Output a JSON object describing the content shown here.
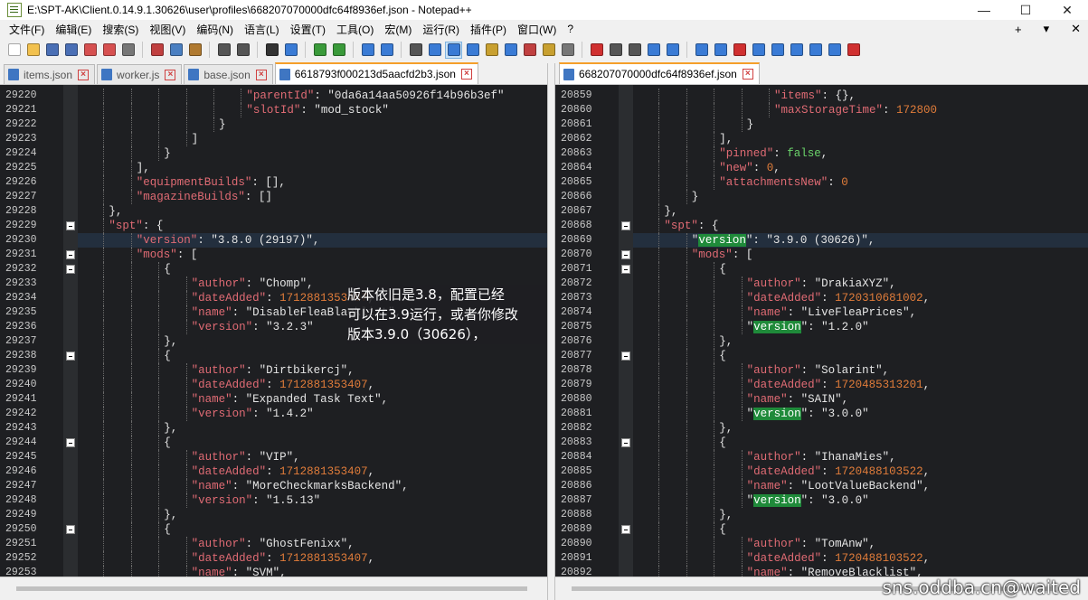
{
  "window": {
    "title": "E:\\SPT-AK\\Client.0.14.9.1.30626\\user\\profiles\\668207070000dfc64f8936ef.json - Notepad++",
    "minimize": "—",
    "maximize": "☐",
    "close": "✕"
  },
  "menu": {
    "items": [
      "文件(F)",
      "编辑(E)",
      "搜索(S)",
      "视图(V)",
      "编码(N)",
      "语言(L)",
      "设置(T)",
      "工具(O)",
      "宏(M)",
      "运行(R)",
      "插件(P)",
      "窗口(W)",
      "?"
    ],
    "plus": "+",
    "dropdown": "▾",
    "close": "✕"
  },
  "left_pane": {
    "tabs": [
      {
        "label": "items.json",
        "active": false
      },
      {
        "label": "worker.js",
        "active": false
      },
      {
        "label": "base.json",
        "active": false
      },
      {
        "label": "6618793f000213d5aacfd2b3.json",
        "active": true
      }
    ],
    "lines": [
      {
        "n": "29220",
        "indent": 6,
        "segs": [
          [
            "key",
            "\"parentId\""
          ],
          [
            "str",
            ": "
          ],
          [
            "str",
            "\"0da6a14aa50926f14b96b3ef\""
          ]
        ]
      },
      {
        "n": "29221",
        "indent": 6,
        "segs": [
          [
            "key",
            "\"slotId\""
          ],
          [
            "str",
            ": "
          ],
          [
            "str",
            "\"mod_stock\""
          ]
        ]
      },
      {
        "n": "29222",
        "indent": 5,
        "segs": [
          [
            "str",
            "}"
          ]
        ]
      },
      {
        "n": "29223",
        "indent": 4,
        "segs": [
          [
            "str",
            "]"
          ]
        ]
      },
      {
        "n": "29224",
        "indent": 3,
        "segs": [
          [
            "str",
            "}"
          ]
        ]
      },
      {
        "n": "29225",
        "indent": 2,
        "segs": [
          [
            "str",
            "],"
          ]
        ]
      },
      {
        "n": "29226",
        "indent": 2,
        "segs": [
          [
            "key",
            "\"equipmentBuilds\""
          ],
          [
            "str",
            ": [],"
          ]
        ]
      },
      {
        "n": "29227",
        "indent": 2,
        "segs": [
          [
            "key",
            "\"magazineBuilds\""
          ],
          [
            "str",
            ": []"
          ]
        ]
      },
      {
        "n": "29228",
        "indent": 1,
        "segs": [
          [
            "str",
            "},"
          ]
        ]
      },
      {
        "n": "29229",
        "indent": 1,
        "fold": true,
        "segs": [
          [
            "key",
            "\"spt\""
          ],
          [
            "str",
            ": {"
          ]
        ]
      },
      {
        "n": "29230",
        "indent": 2,
        "cur": true,
        "segs": [
          [
            "key",
            "\"version\""
          ],
          [
            "str",
            ": "
          ],
          [
            "str",
            "\"3.8.0 (29197)\""
          ],
          [
            "str",
            ","
          ]
        ]
      },
      {
        "n": "29231",
        "indent": 2,
        "fold": true,
        "segs": [
          [
            "key",
            "\"mods\""
          ],
          [
            "str",
            ": ["
          ]
        ]
      },
      {
        "n": "29232",
        "indent": 3,
        "fold": true,
        "segs": [
          [
            "str",
            "{"
          ]
        ]
      },
      {
        "n": "29233",
        "indent": 4,
        "segs": [
          [
            "key",
            "\"author\""
          ],
          [
            "str",
            ": "
          ],
          [
            "str",
            "\"Chomp\""
          ],
          [
            "str",
            ","
          ]
        ]
      },
      {
        "n": "29234",
        "indent": 4,
        "segs": [
          [
            "key",
            "\"dateAdded\""
          ],
          [
            "str",
            ": "
          ],
          [
            "num",
            "1712881353407"
          ],
          [
            "str",
            ","
          ]
        ]
      },
      {
        "n": "29235",
        "indent": 4,
        "segs": [
          [
            "key",
            "\"name\""
          ],
          [
            "str",
            ": "
          ],
          [
            "str",
            "\"DisableFleaBlacklist\""
          ],
          [
            "str",
            ","
          ]
        ]
      },
      {
        "n": "29236",
        "indent": 4,
        "segs": [
          [
            "key",
            "\"version\""
          ],
          [
            "str",
            ": "
          ],
          [
            "str",
            "\"3.2.3\""
          ]
        ]
      },
      {
        "n": "29237",
        "indent": 3,
        "segs": [
          [
            "str",
            "},"
          ]
        ]
      },
      {
        "n": "29238",
        "indent": 3,
        "fold": true,
        "segs": [
          [
            "str",
            "{"
          ]
        ]
      },
      {
        "n": "29239",
        "indent": 4,
        "segs": [
          [
            "key",
            "\"author\""
          ],
          [
            "str",
            ": "
          ],
          [
            "str",
            "\"Dirtbikercj\""
          ],
          [
            "str",
            ","
          ]
        ]
      },
      {
        "n": "29240",
        "indent": 4,
        "segs": [
          [
            "key",
            "\"dateAdded\""
          ],
          [
            "str",
            ": "
          ],
          [
            "num",
            "1712881353407"
          ],
          [
            "str",
            ","
          ]
        ]
      },
      {
        "n": "29241",
        "indent": 4,
        "segs": [
          [
            "key",
            "\"name\""
          ],
          [
            "str",
            ": "
          ],
          [
            "str",
            "\"Expanded Task Text\""
          ],
          [
            "str",
            ","
          ]
        ]
      },
      {
        "n": "29242",
        "indent": 4,
        "segs": [
          [
            "key",
            "\"version\""
          ],
          [
            "str",
            ": "
          ],
          [
            "str",
            "\"1.4.2\""
          ]
        ]
      },
      {
        "n": "29243",
        "indent": 3,
        "segs": [
          [
            "str",
            "},"
          ]
        ]
      },
      {
        "n": "29244",
        "indent": 3,
        "fold": true,
        "segs": [
          [
            "str",
            "{"
          ]
        ]
      },
      {
        "n": "29245",
        "indent": 4,
        "segs": [
          [
            "key",
            "\"author\""
          ],
          [
            "str",
            ": "
          ],
          [
            "str",
            "\"VIP\""
          ],
          [
            "str",
            ","
          ]
        ]
      },
      {
        "n": "29246",
        "indent": 4,
        "segs": [
          [
            "key",
            "\"dateAdded\""
          ],
          [
            "str",
            ": "
          ],
          [
            "num",
            "1712881353407"
          ],
          [
            "str",
            ","
          ]
        ]
      },
      {
        "n": "29247",
        "indent": 4,
        "segs": [
          [
            "key",
            "\"name\""
          ],
          [
            "str",
            ": "
          ],
          [
            "str",
            "\"MoreCheckmarksBackend\""
          ],
          [
            "str",
            ","
          ]
        ]
      },
      {
        "n": "29248",
        "indent": 4,
        "segs": [
          [
            "key",
            "\"version\""
          ],
          [
            "str",
            ": "
          ],
          [
            "str",
            "\"1.5.13\""
          ]
        ]
      },
      {
        "n": "29249",
        "indent": 3,
        "segs": [
          [
            "str",
            "},"
          ]
        ]
      },
      {
        "n": "29250",
        "indent": 3,
        "fold": true,
        "segs": [
          [
            "str",
            "{"
          ]
        ]
      },
      {
        "n": "29251",
        "indent": 4,
        "segs": [
          [
            "key",
            "\"author\""
          ],
          [
            "str",
            ": "
          ],
          [
            "str",
            "\"GhostFenixx\""
          ],
          [
            "str",
            ","
          ]
        ]
      },
      {
        "n": "29252",
        "indent": 4,
        "segs": [
          [
            "key",
            "\"dateAdded\""
          ],
          [
            "str",
            ": "
          ],
          [
            "num",
            "1712881353407"
          ],
          [
            "str",
            ","
          ]
        ]
      },
      {
        "n": "29253",
        "indent": 4,
        "segs": [
          [
            "key",
            "\"name\""
          ],
          [
            "str",
            ": "
          ],
          [
            "str",
            "\"SVM\""
          ],
          [
            "str",
            ","
          ]
        ]
      }
    ]
  },
  "right_pane": {
    "tabs": [
      {
        "label": "668207070000dfc64f8936ef.json",
        "active": true
      }
    ],
    "lines": [
      {
        "n": "20859",
        "indent": 5,
        "segs": [
          [
            "key",
            "\"items\""
          ],
          [
            "str",
            ": {},"
          ]
        ]
      },
      {
        "n": "20860",
        "indent": 5,
        "segs": [
          [
            "key",
            "\"maxStorageTime\""
          ],
          [
            "str",
            ": "
          ],
          [
            "num",
            "172800"
          ]
        ]
      },
      {
        "n": "20861",
        "indent": 4,
        "segs": [
          [
            "str",
            "}"
          ]
        ]
      },
      {
        "n": "20862",
        "indent": 3,
        "segs": [
          [
            "str",
            "],"
          ]
        ]
      },
      {
        "n": "20863",
        "indent": 3,
        "segs": [
          [
            "key",
            "\"pinned\""
          ],
          [
            "str",
            ": "
          ],
          [
            "kw",
            "false"
          ],
          [
            "str",
            ","
          ]
        ]
      },
      {
        "n": "20864",
        "indent": 3,
        "segs": [
          [
            "key",
            "\"new\""
          ],
          [
            "str",
            ": "
          ],
          [
            "num",
            "0"
          ],
          [
            "str",
            ","
          ]
        ]
      },
      {
        "n": "20865",
        "indent": 3,
        "segs": [
          [
            "key",
            "\"attachmentsNew\""
          ],
          [
            "str",
            ": "
          ],
          [
            "num",
            "0"
          ]
        ]
      },
      {
        "n": "20866",
        "indent": 2,
        "segs": [
          [
            "str",
            "}"
          ]
        ]
      },
      {
        "n": "20867",
        "indent": 1,
        "segs": [
          [
            "str",
            "},"
          ]
        ]
      },
      {
        "n": "20868",
        "indent": 1,
        "fold": true,
        "segs": [
          [
            "key",
            "\"spt\""
          ],
          [
            "str",
            ": {"
          ]
        ]
      },
      {
        "n": "20869",
        "indent": 2,
        "cur": true,
        "segs": [
          [
            "str",
            "\""
          ],
          [
            "hl",
            "version"
          ],
          [
            "str",
            "\": "
          ],
          [
            "str",
            "\"3.9.0 (30626)\""
          ],
          [
            "str",
            ","
          ]
        ]
      },
      {
        "n": "20870",
        "indent": 2,
        "fold": true,
        "segs": [
          [
            "key",
            "\"mods\""
          ],
          [
            "str",
            ": ["
          ]
        ]
      },
      {
        "n": "20871",
        "indent": 3,
        "fold": true,
        "segs": [
          [
            "str",
            "{"
          ]
        ]
      },
      {
        "n": "20872",
        "indent": 4,
        "segs": [
          [
            "key",
            "\"author\""
          ],
          [
            "str",
            ": "
          ],
          [
            "str",
            "\"DrakiaXYZ\""
          ],
          [
            "str",
            ","
          ]
        ]
      },
      {
        "n": "20873",
        "indent": 4,
        "segs": [
          [
            "key",
            "\"dateAdded\""
          ],
          [
            "str",
            ": "
          ],
          [
            "num",
            "1720310681002"
          ],
          [
            "str",
            ","
          ]
        ]
      },
      {
        "n": "20874",
        "indent": 4,
        "segs": [
          [
            "key",
            "\"name\""
          ],
          [
            "str",
            ": "
          ],
          [
            "str",
            "\"LiveFleaPrices\""
          ],
          [
            "str",
            ","
          ]
        ]
      },
      {
        "n": "20875",
        "indent": 4,
        "segs": [
          [
            "str",
            "\""
          ],
          [
            "hl",
            "version"
          ],
          [
            "str",
            "\": "
          ],
          [
            "str",
            "\"1.2.0\""
          ]
        ]
      },
      {
        "n": "20876",
        "indent": 3,
        "segs": [
          [
            "str",
            "},"
          ]
        ]
      },
      {
        "n": "20877",
        "indent": 3,
        "fold": true,
        "segs": [
          [
            "str",
            "{"
          ]
        ]
      },
      {
        "n": "20878",
        "indent": 4,
        "segs": [
          [
            "key",
            "\"author\""
          ],
          [
            "str",
            ": "
          ],
          [
            "str",
            "\"Solarint\""
          ],
          [
            "str",
            ","
          ]
        ]
      },
      {
        "n": "20879",
        "indent": 4,
        "segs": [
          [
            "key",
            "\"dateAdded\""
          ],
          [
            "str",
            ": "
          ],
          [
            "num",
            "1720485313201"
          ],
          [
            "str",
            ","
          ]
        ]
      },
      {
        "n": "20880",
        "indent": 4,
        "segs": [
          [
            "key",
            "\"name\""
          ],
          [
            "str",
            ": "
          ],
          [
            "str",
            "\"SAIN\""
          ],
          [
            "str",
            ","
          ]
        ]
      },
      {
        "n": "20881",
        "indent": 4,
        "segs": [
          [
            "str",
            "\""
          ],
          [
            "hl",
            "version"
          ],
          [
            "str",
            "\": "
          ],
          [
            "str",
            "\"3.0.0\""
          ]
        ]
      },
      {
        "n": "20882",
        "indent": 3,
        "segs": [
          [
            "str",
            "},"
          ]
        ]
      },
      {
        "n": "20883",
        "indent": 3,
        "fold": true,
        "segs": [
          [
            "str",
            "{"
          ]
        ]
      },
      {
        "n": "20884",
        "indent": 4,
        "segs": [
          [
            "key",
            "\"author\""
          ],
          [
            "str",
            ": "
          ],
          [
            "str",
            "\"IhanaMies\""
          ],
          [
            "str",
            ","
          ]
        ]
      },
      {
        "n": "20885",
        "indent": 4,
        "segs": [
          [
            "key",
            "\"dateAdded\""
          ],
          [
            "str",
            ": "
          ],
          [
            "num",
            "1720488103522"
          ],
          [
            "str",
            ","
          ]
        ]
      },
      {
        "n": "20886",
        "indent": 4,
        "segs": [
          [
            "key",
            "\"name\""
          ],
          [
            "str",
            ": "
          ],
          [
            "str",
            "\"LootValueBackend\""
          ],
          [
            "str",
            ","
          ]
        ]
      },
      {
        "n": "20887",
        "indent": 4,
        "segs": [
          [
            "str",
            "\""
          ],
          [
            "hl",
            "version"
          ],
          [
            "str",
            "\": "
          ],
          [
            "str",
            "\"3.0.0\""
          ]
        ]
      },
      {
        "n": "20888",
        "indent": 3,
        "segs": [
          [
            "str",
            "},"
          ]
        ]
      },
      {
        "n": "20889",
        "indent": 3,
        "fold": true,
        "segs": [
          [
            "str",
            "{"
          ]
        ]
      },
      {
        "n": "20890",
        "indent": 4,
        "segs": [
          [
            "key",
            "\"author\""
          ],
          [
            "str",
            ": "
          ],
          [
            "str",
            "\"TomAnw\""
          ],
          [
            "str",
            ","
          ]
        ]
      },
      {
        "n": "20891",
        "indent": 4,
        "segs": [
          [
            "key",
            "\"dateAdded\""
          ],
          [
            "str",
            ": "
          ],
          [
            "num",
            "1720488103522"
          ],
          [
            "str",
            ","
          ]
        ]
      },
      {
        "n": "20892",
        "indent": 4,
        "segs": [
          [
            "key",
            "\"name\""
          ],
          [
            "str",
            ": "
          ],
          [
            "str",
            "\"RemoveBlacklist\""
          ],
          [
            "str",
            ","
          ]
        ]
      }
    ]
  },
  "annotation": {
    "lines": [
      "版本依旧是3.8，配置已经",
      "可以在3.9运行，或者你修改",
      "版本3.9.0（30626），"
    ]
  },
  "watermark": "sns.oddba.cn@waited",
  "colors": {
    "editor_bg": "#1e1f22",
    "key": "#e06b74",
    "number": "#e07c3a",
    "keyword": "#6bd46b",
    "highlight": "#1f8a3a",
    "active_tab_accent": "#f59f2a"
  }
}
